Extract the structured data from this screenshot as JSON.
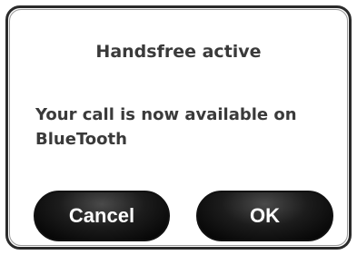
{
  "dialog": {
    "title": "Handsfree active",
    "message_line1": "Your call is now available on",
    "message_line2": "BlueTooth"
  },
  "buttons": {
    "cancel_label": "Cancel",
    "ok_label": "OK"
  },
  "colors": {
    "text": "#3a3a3a",
    "button_bg": "#111111",
    "button_text": "#ffffff",
    "border": "#2b2b2b"
  }
}
